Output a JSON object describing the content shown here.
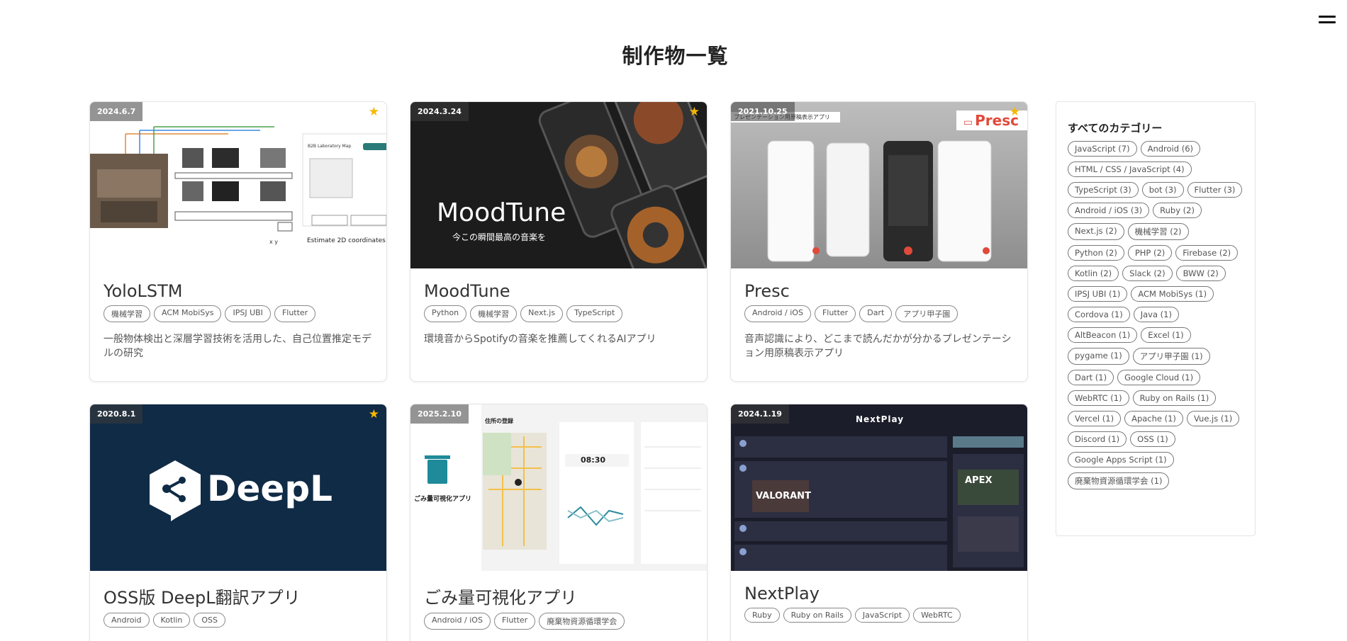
{
  "page": {
    "title": "制作物一覧"
  },
  "sidebar": {
    "title": "すべてのカテゴリー",
    "categories": [
      "JavaScript (7)",
      "Android (6)",
      "HTML / CSS / JavaScript (4)",
      "TypeScript (3)",
      "bot (3)",
      "Flutter (3)",
      "Android / iOS (3)",
      "Ruby (2)",
      "Next.js (2)",
      "機械学習 (2)",
      "Python (2)",
      "PHP (2)",
      "Firebase (2)",
      "Kotlin (2)",
      "Slack (2)",
      "BWW (2)",
      "IPSJ UBI (1)",
      "ACM MobiSys (1)",
      "Cordova (1)",
      "Java (1)",
      "AltBeacon (1)",
      "Excel (1)",
      "pygame (1)",
      "アプリ甲子園 (1)",
      "Dart (1)",
      "Google Cloud (1)",
      "WebRTC (1)",
      "Ruby on Rails (1)",
      "Vercel (1)",
      "Apache (1)",
      "Vue.js (1)",
      "Discord (1)",
      "OSS (1)",
      "Google Apps Script (1)",
      "廃棄物資源循環学会 (1)"
    ]
  },
  "cards": [
    {
      "date": "2024.6.7",
      "title": "YoloLSTM",
      "tags": [
        "機械学習",
        "ACM MobiSys",
        "IPSJ UBI",
        "Flutter"
      ],
      "desc": "一般物体検出と深層学習技術を活用した、自己位置推定モデルの研究",
      "thumb": {
        "map_title": "B2B Laboratory Map",
        "caption": "Estimate 2D coordinates (x, y)"
      }
    },
    {
      "date": "2024.3.24",
      "title": "MoodTune",
      "tags": [
        "Python",
        "機械学習",
        "Next.js",
        "TypeScript"
      ],
      "desc": "環境音からSpotifyの音楽を推薦してくれるAIアプリ",
      "thumb": {
        "logo": "MoodTune",
        "tagline": "今この瞬間最高の音楽を"
      }
    },
    {
      "date": "2021.10.25",
      "title": "Presc",
      "tags": [
        "Android / iOS",
        "Flutter",
        "Dart",
        "アプリ甲子園"
      ],
      "desc": "音声認識により、どこまで読んだかが分かるプレゼンテーション用原稿表示アプリ",
      "thumb": {
        "banner": "プレゼンテーション用原稿表示アプリ",
        "logo": "Presc"
      }
    },
    {
      "date": "2020.8.1",
      "title": "OSS版 DeepL翻訳アプリ",
      "tags": [
        "Android",
        "Kotlin",
        "OSS"
      ],
      "desc": "",
      "thumb": {
        "logo": "DeepL"
      }
    },
    {
      "date": "2025.2.10",
      "title": "ごみ量可視化アプリ",
      "tags": [
        "Android / iOS",
        "Flutter",
        "廃棄物資源循環学会"
      ],
      "desc": "",
      "thumb": {
        "app_name": "ごみ量可視化アプリ",
        "map_title": "住所の登録",
        "time": "08:30"
      }
    },
    {
      "date": "2024.1.19",
      "title": "NextPlay",
      "tags": [
        "Ruby",
        "Ruby on Rails",
        "JavaScript",
        "WebRTC"
      ],
      "desc": "",
      "thumb": {
        "logo": "NextPlay",
        "game": "VALORANT",
        "game2": "APEX"
      }
    }
  ]
}
